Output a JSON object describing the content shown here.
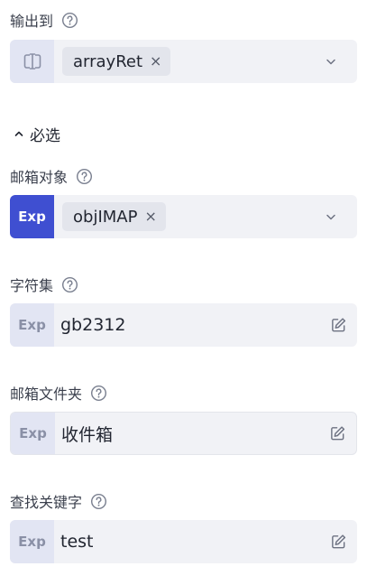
{
  "output": {
    "label": "输出到",
    "prefix_icon": "variable-icon",
    "tag": "arrayRet",
    "tag_close": "×"
  },
  "section": {
    "label": "必选",
    "state": "expanded"
  },
  "mailbox": {
    "label": "邮箱对象",
    "prefix": "Exp",
    "tag": "objIMAP",
    "tag_close": "×"
  },
  "charset": {
    "label": "字符集",
    "prefix": "Exp",
    "value": "gb2312"
  },
  "folder": {
    "label": "邮箱文件夹",
    "prefix": "Exp",
    "value": "收件箱"
  },
  "keyword": {
    "label": "查找关键字",
    "prefix": "Exp",
    "value": "test"
  },
  "colors": {
    "accent": "#3f4fd1",
    "field_bg": "#f1f2f6",
    "prefix_bg": "#e2e5f3"
  }
}
